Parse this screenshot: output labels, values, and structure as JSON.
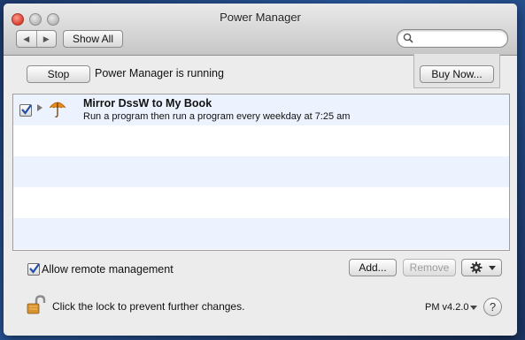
{
  "window": {
    "title": "Power Manager"
  },
  "toolbar": {
    "back_glyph": "◀",
    "forward_glyph": "▶",
    "show_all_label": "Show All",
    "search_placeholder": ""
  },
  "status": {
    "stop_label": "Stop",
    "text": "Power Manager is running",
    "buy_label": "Buy Now..."
  },
  "tasks": [
    {
      "enabled": true,
      "icon": "umbrella-icon",
      "title": "Mirror DssW to My Book",
      "description": "Run a program then run a program every weekday at 7:25 am"
    }
  ],
  "footer": {
    "allow_remote_label": "Allow remote management",
    "allow_remote_checked": true,
    "add_label": "Add...",
    "remove_label": "Remove",
    "lock_text": "Click the lock to prevent further changes.",
    "version": "PM v4.2.0",
    "help_label": "?"
  },
  "colors": {
    "stripe_alt": "#edf3fe",
    "checkmark": "#1f4fa8",
    "umbrella": "#e88a1a"
  }
}
